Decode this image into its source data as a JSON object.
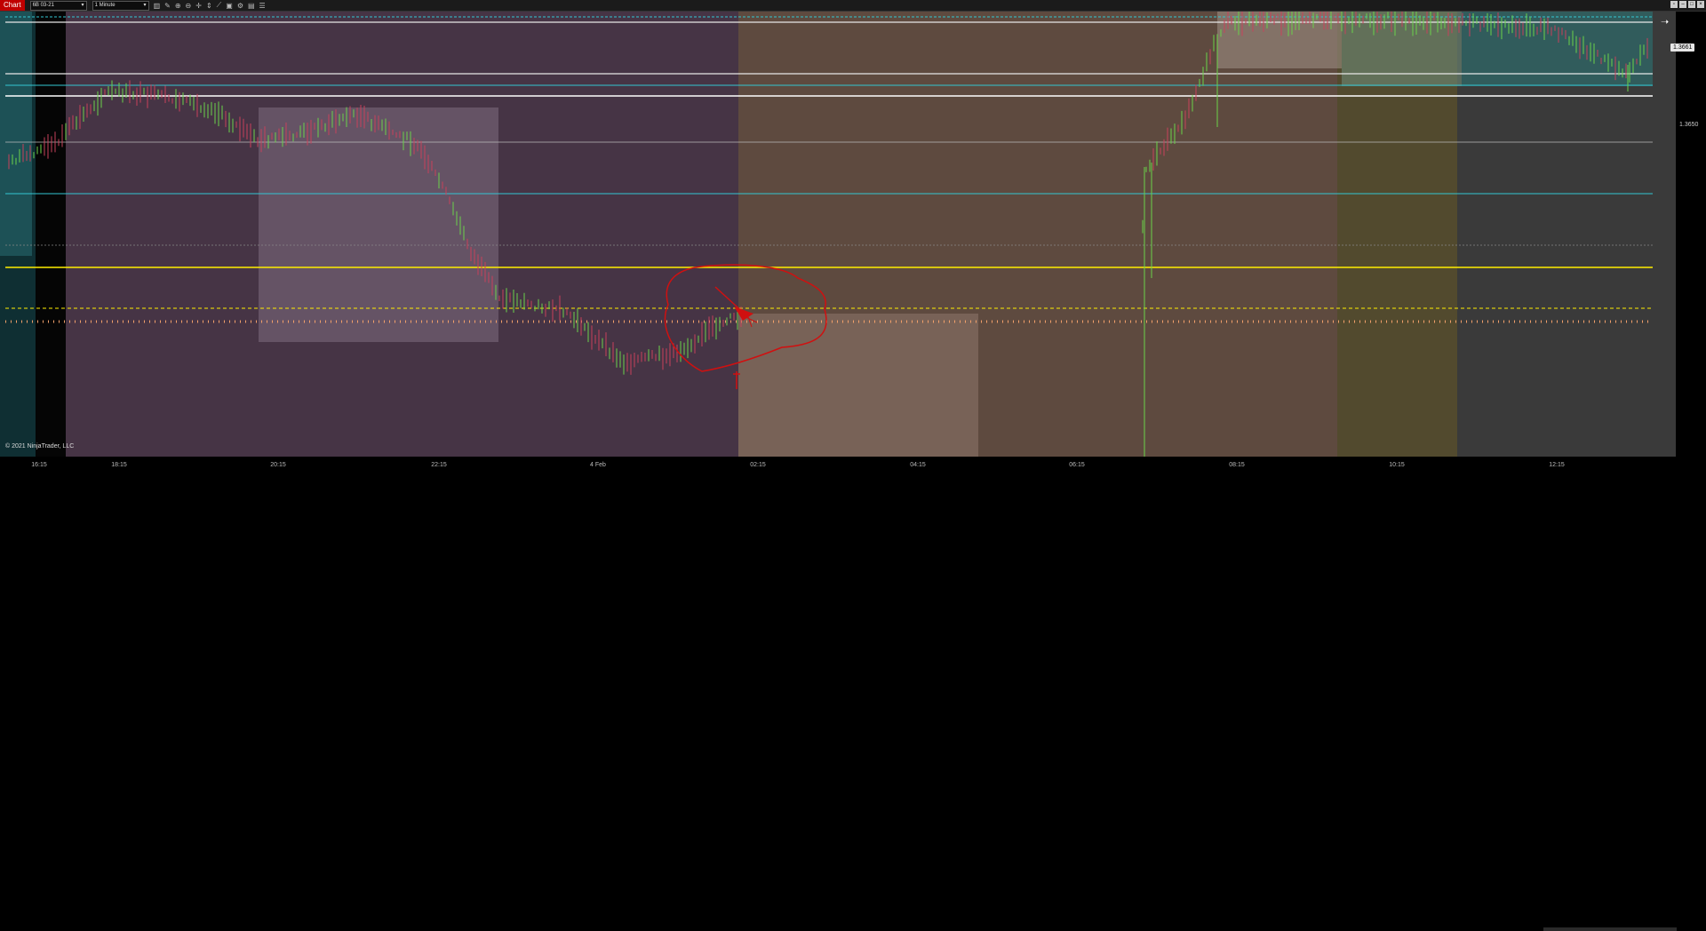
{
  "toolbar": {
    "tab_label": "Chart",
    "instrument": "6B 03-21",
    "interval": "1 Minute",
    "icons": [
      "bars-icon",
      "pencil-icon",
      "zoom-in-icon",
      "zoom-out-icon",
      "crosshair-icon",
      "scale-icon",
      "draw-icon",
      "snapshot-icon",
      "strategy-icon",
      "properties-icon",
      "list-icon"
    ]
  },
  "window_buttons": [
    "restore",
    "minimize",
    "maximize",
    "close"
  ],
  "chart": {
    "copyright": "© 2021 NinjaTrader, LLC",
    "price_label": "1.3661",
    "y_ticks": [
      "1.3650"
    ],
    "x_ticks": [
      "16:15",
      "18:15",
      "20:15",
      "22:15",
      "4 Feb",
      "02:15",
      "04:15",
      "06:15",
      "08:15",
      "10:15",
      "12:15"
    ],
    "colors": {
      "session_purple": "#463445",
      "session_brown": "#5e4a3f",
      "session_olive": "#524a2e",
      "session_gray": "#3a3a3a",
      "up_bar": "#6ad24a",
      "down_bar": "#c8415b",
      "level_white": "#e8e8e8",
      "level_cyan": "#33c6d2",
      "level_yellow": "#ffee00",
      "annotation_red": "#d01010"
    }
  }
}
